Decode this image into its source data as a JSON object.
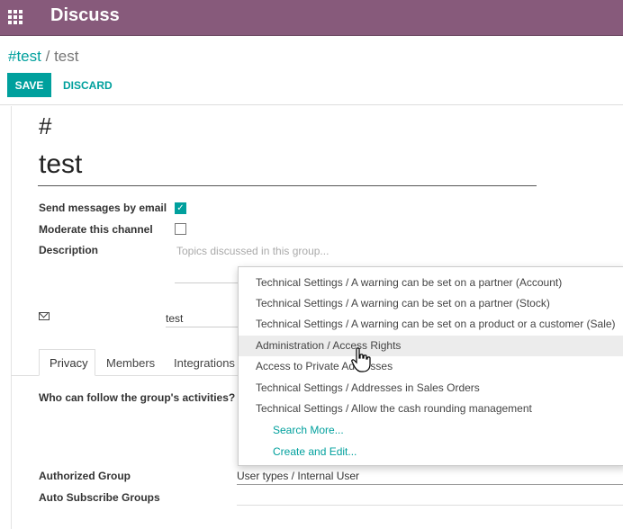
{
  "app": {
    "title": "Discuss"
  },
  "breadcrumb": {
    "parent": "#test",
    "separator": "/",
    "current": "test"
  },
  "buttons": {
    "save": "SAVE",
    "discard": "DISCARD"
  },
  "form": {
    "prefix": "#",
    "name": "test",
    "send_email_label": "Send messages by email",
    "send_email_checked": true,
    "moderate_label": "Moderate this channel",
    "moderate_checked": false,
    "description_label": "Description",
    "description_placeholder": "Topics discussed in this group...",
    "alias_icon": "envelope-icon",
    "alias_value": "test",
    "tabs": [
      "Privacy",
      "Members",
      "Integrations"
    ],
    "active_tab": "Privacy",
    "follow_question": "Who can follow the group's activities?",
    "authorized_group_label": "Authorized Group",
    "authorized_group_value": "User types / Internal User",
    "auto_subscribe_label": "Auto Subscribe Groups"
  },
  "dropdown": {
    "items": [
      "Technical Settings / A warning can be set on a partner (Account)",
      "Technical Settings / A warning can be set on a partner (Stock)",
      "Technical Settings / A warning can be set on a product or a customer (Sale)",
      "Administration / Access Rights",
      "Access to Private Addresses",
      "Technical Settings / Addresses in Sales Orders",
      "Technical Settings / Allow the cash rounding management"
    ],
    "hovered_index": 3,
    "search_more": "Search More...",
    "create_and_edit": "Create and Edit..."
  },
  "colors": {
    "brand": "#875a7b",
    "accent": "#00a09d"
  }
}
